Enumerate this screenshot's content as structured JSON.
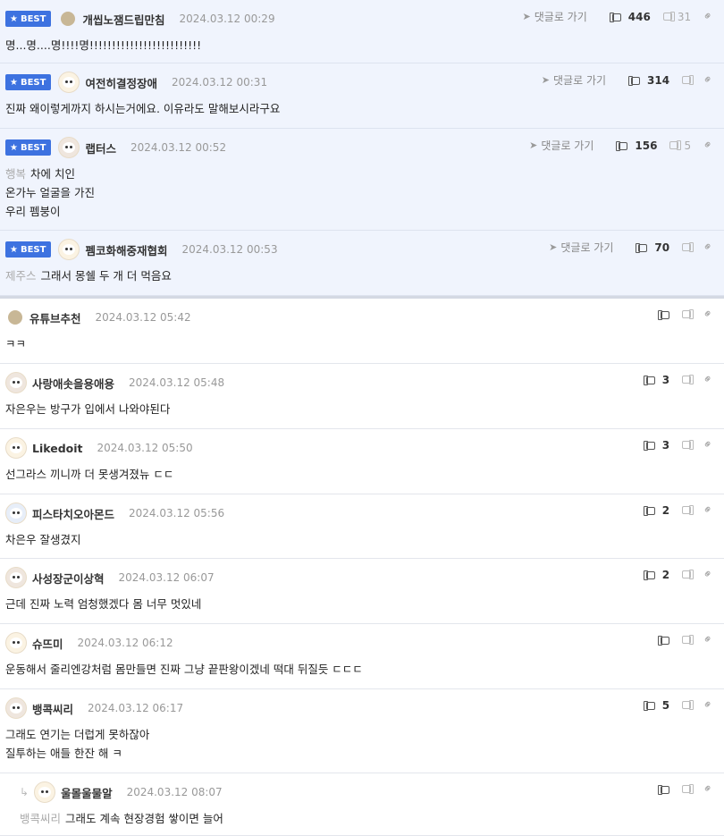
{
  "common": {
    "reply_goto": "댓글로 가기",
    "best_label": "BEST"
  },
  "best_comments": [
    {
      "nick": "개씹노잼드립만침",
      "date": "2024.03.12 00:29",
      "text_lines": [
        "명...명....명!!!!명!!!!!!!!!!!!!!!!!!!!!!!!!"
      ],
      "prefix": "",
      "up": "446",
      "down": "31",
      "avatar": "dot"
    },
    {
      "nick": "여전히결정장애",
      "date": "2024.03.12 00:31",
      "text_lines": [
        "진짜 왜이렇게까지 하시는거에요. 이유라도 말해보시라구요"
      ],
      "prefix": "",
      "up": "314",
      "down": "",
      "avatar": "dog1"
    },
    {
      "nick": "랩터스",
      "date": "2024.03.12 00:52",
      "text_lines": [
        "차에 치인",
        "온가누 얼굴을 가진",
        "우리 펨붕이"
      ],
      "prefix": "행복",
      "up": "156",
      "down": "5",
      "avatar": "dog2"
    },
    {
      "nick": "펨코화해중재협회",
      "date": "2024.03.12 00:53",
      "text_lines": [
        "그래서 몽쉘 두 개 더 먹음요"
      ],
      "prefix": "제주스",
      "up": "70",
      "down": "",
      "avatar": "dog1"
    }
  ],
  "comments": [
    {
      "nick": "유튜브추천",
      "date": "2024.03.12 05:42",
      "text_lines": [
        "ㅋㅋ"
      ],
      "prefix": "",
      "up": "",
      "avatar": "dot"
    },
    {
      "nick": "사랑애솟을용애용",
      "date": "2024.03.12 05:48",
      "text_lines": [
        "자은우는 방구가 입에서 나와야된다"
      ],
      "prefix": "",
      "up": "3",
      "avatar": "dog2"
    },
    {
      "nick": "Likedoit",
      "date": "2024.03.12 05:50",
      "text_lines": [
        "선그라스 끼니까 더 못생겨졌뉴 ㄷㄷ"
      ],
      "prefix": "",
      "up": "3",
      "avatar": "dog1"
    },
    {
      "nick": "피스타치오아몬드",
      "date": "2024.03.12 05:56",
      "text_lines": [
        "차은우 잘생겼지"
      ],
      "prefix": "",
      "up": "2",
      "avatar": "dog3"
    },
    {
      "nick": "사성장군이상혁",
      "date": "2024.03.12 06:07",
      "text_lines": [
        "근데 진짜 노력 엄청했겠다 몸 너무 멋있네"
      ],
      "prefix": "",
      "up": "2",
      "avatar": "dog2"
    },
    {
      "nick": "슈뜨미",
      "date": "2024.03.12 06:12",
      "text_lines": [
        "운동해서 줄리엔강처럼 몸만들면 진짜 그냥 끝판왕이겠네 떡대 뒤질듯 ㄷㄷㄷ"
      ],
      "prefix": "",
      "up": "",
      "avatar": "dog1"
    },
    {
      "nick": "뱅콕씨리",
      "date": "2024.03.12 06:17",
      "text_lines": [
        "그래도 연기는 더럽게 못하잖아",
        "질투하는 애들 한잔 해 ㅋ"
      ],
      "prefix": "",
      "up": "5",
      "avatar": "dog2"
    },
    {
      "nick": "울몰울물알",
      "date": "2024.03.12 08:07",
      "text_lines": [
        "그래도 계속 현장경험 쌓이면 늘어"
      ],
      "prefix": "뱅콕씨리",
      "up": "",
      "avatar": "dog1",
      "is_reply": true
    }
  ],
  "colors": {
    "best_bg": "#f0f4fd",
    "badge": "#3d72e0"
  },
  "icons": {
    "upvote": "thumb-up-icon",
    "downvote": "thumb-down-icon",
    "link": "link-icon",
    "reply_goto": "send-arrow-icon",
    "reply_indent": "reply-arrow-icon"
  }
}
